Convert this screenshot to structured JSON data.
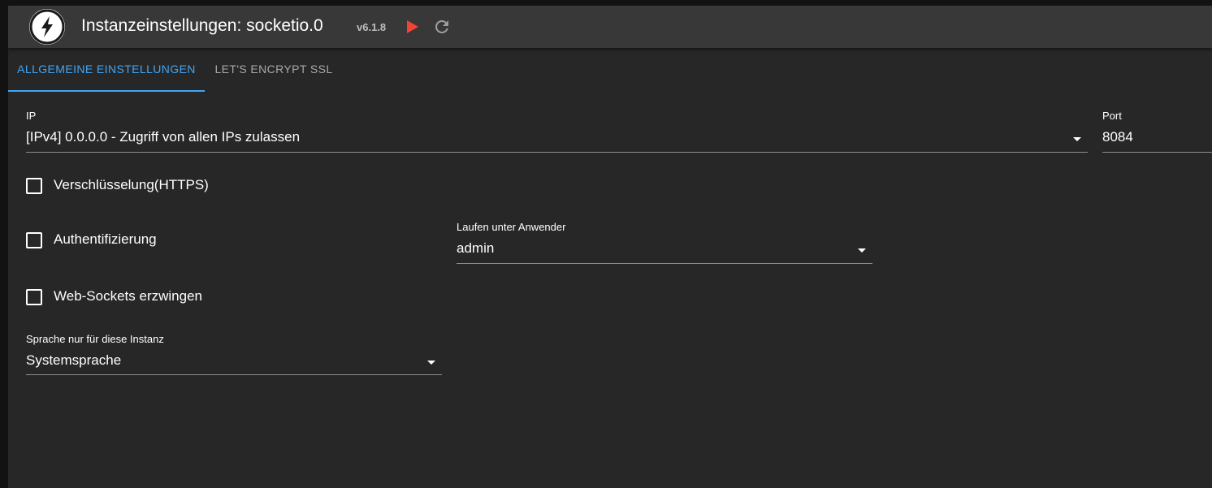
{
  "header": {
    "title": "Instanzeinstellungen: socketio.0",
    "version": "v6.1.8",
    "logo_icon": "socketio-logo-icon",
    "start_icon": "play-icon",
    "reload_icon": "reload-icon",
    "start_color": "#f44336"
  },
  "tabs": [
    {
      "label": "ALLGEMEINE EINSTELLUNGEN",
      "active": true
    },
    {
      "label": "LET'S ENCRYPT SSL",
      "active": false
    }
  ],
  "form": {
    "ip": {
      "label": "IP",
      "value": "[IPv4] 0.0.0.0 - Zugriff von allen IPs zulassen"
    },
    "port": {
      "label": "Port",
      "value": "8084"
    },
    "https": {
      "label": "Verschlüsselung(HTTPS)",
      "checked": false
    },
    "auth": {
      "label": "Authentifizierung",
      "checked": false
    },
    "default_user": {
      "label": "Laufen unter Anwender",
      "value": "admin"
    },
    "force_websockets": {
      "label": "Web-Sockets erzwingen",
      "checked": false
    },
    "language": {
      "label": "Sprache nur für diese Instanz",
      "value": "Systemsprache"
    }
  },
  "colors": {
    "accent": "#42a5f5",
    "background": "#272727",
    "toolbar": "#383838"
  }
}
